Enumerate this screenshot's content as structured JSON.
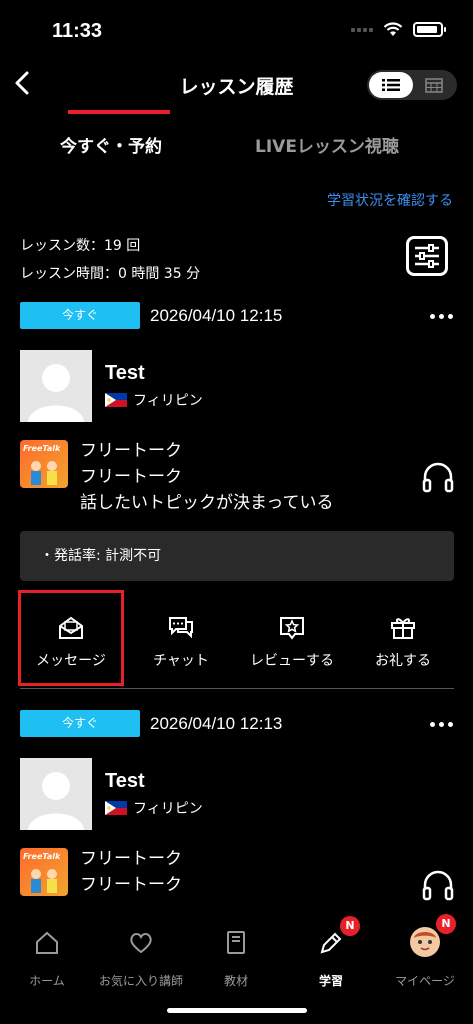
{
  "status_bar": {
    "time": "11:33"
  },
  "nav": {
    "title": "レッスン履歴"
  },
  "tabs": [
    {
      "label": "今すぐ・予約",
      "active": true
    },
    {
      "label": "LIVEレッスン視聴",
      "active": false
    }
  ],
  "progress_link": "学習状況を確認する",
  "stats": {
    "lesson_count": "レッスン数：19 回",
    "lesson_time": "レッスン時間：0 時間 35 分"
  },
  "lessons": [
    {
      "badge": "今すぐ",
      "datetime": "2026/04/10 12:15",
      "teacher_name": "Test",
      "teacher_country": "フィリピン",
      "course_thumb_label": "FreeTalk",
      "course_title": "フリートーク",
      "course_subtitle": "フリートーク",
      "course_topic": "話したいトピックが決まっている",
      "speaking_rate": "・発話率: 計測不可",
      "actions": [
        "メッセージ",
        "チャット",
        "レビューする",
        "お礼する"
      ]
    },
    {
      "badge": "今すぐ",
      "datetime": "2026/04/10 12:13",
      "teacher_name": "Test",
      "teacher_country": "フィリピン",
      "course_thumb_label": "FreeTalk",
      "course_title": "フリートーク",
      "course_subtitle": "フリートーク"
    }
  ],
  "bottom_tabs": [
    {
      "label": "ホーム",
      "icon": "home-icon",
      "active": false
    },
    {
      "label": "お気に入り講師",
      "icon": "heart-icon",
      "active": false
    },
    {
      "label": "教材",
      "icon": "book-icon",
      "active": false
    },
    {
      "label": "学習",
      "icon": "pencil-icon",
      "active": true,
      "badge": "N"
    },
    {
      "label": "マイページ",
      "icon": "avatar-icon",
      "active": false,
      "badge": "N"
    }
  ],
  "colors": {
    "accent": "#e8202a",
    "badge": "#1ec0f3",
    "link": "#3b8ef0"
  }
}
